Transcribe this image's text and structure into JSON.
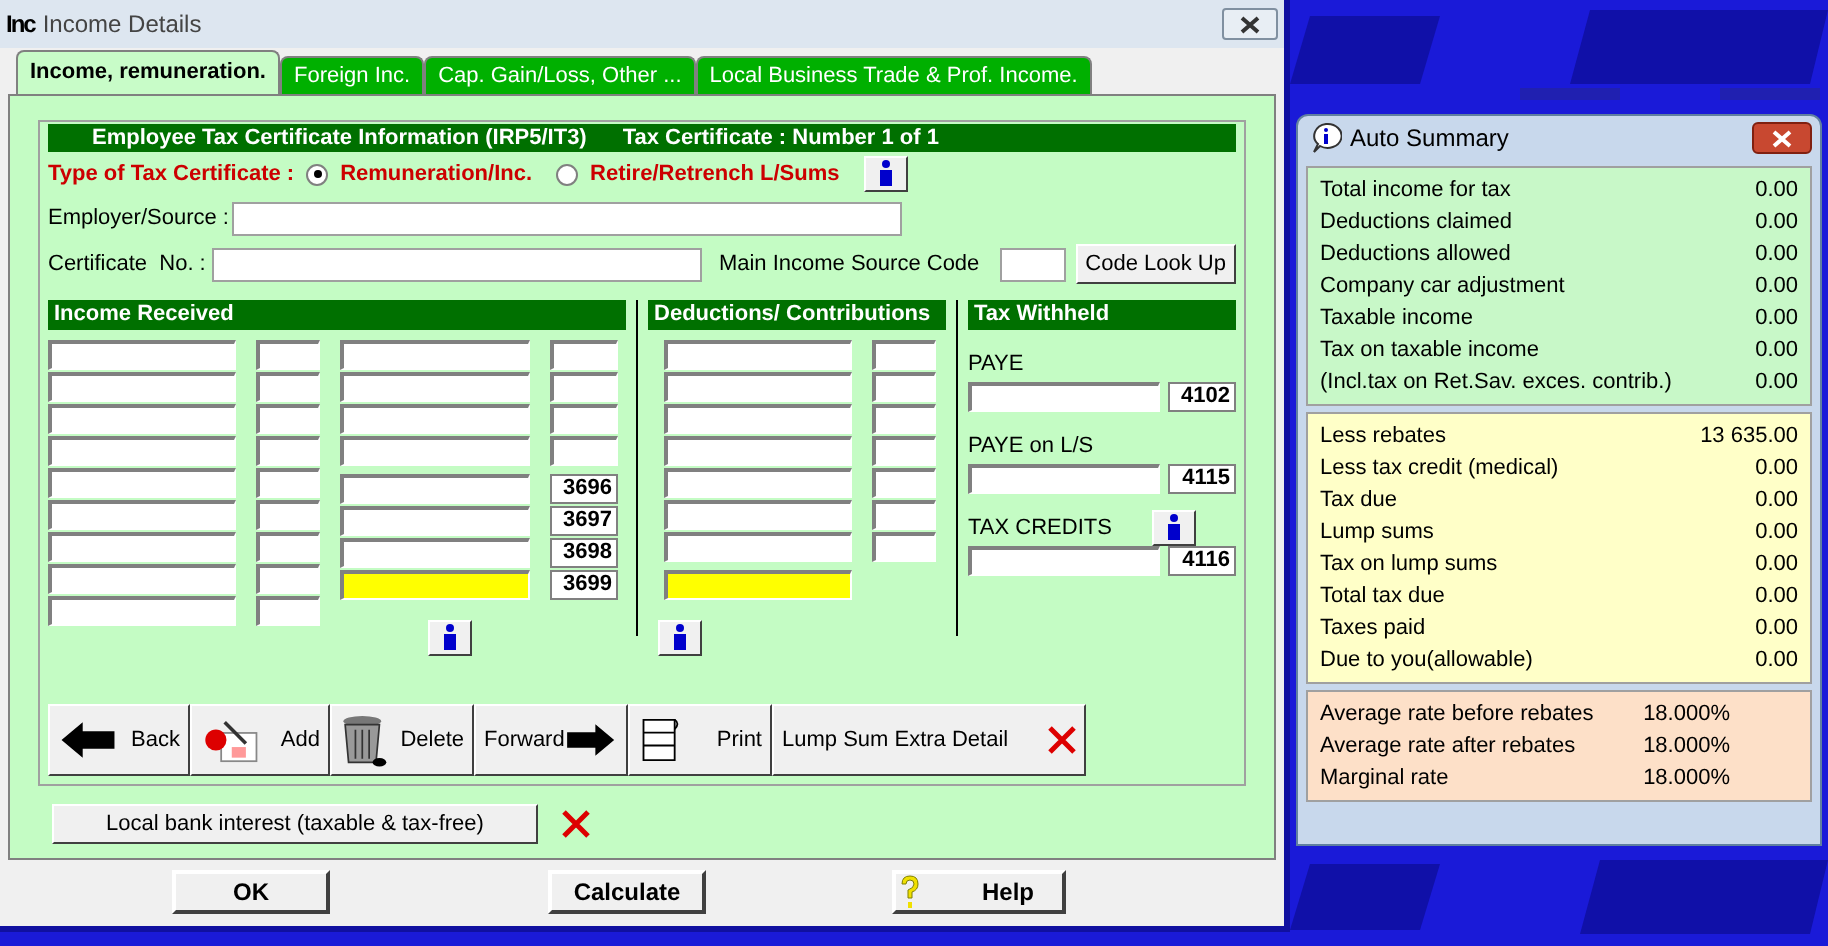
{
  "window": {
    "icon_text": "Inc",
    "title": "Income Details"
  },
  "tabs": [
    {
      "label": "Income, remuneration.",
      "selected": true
    },
    {
      "label": "Foreign Inc.",
      "selected": false
    },
    {
      "label": "Cap. Gain/Loss, Other ...",
      "selected": false
    },
    {
      "label": "Local Business Trade & Prof. Income.",
      "selected": false
    }
  ],
  "certificate": {
    "header": "Employee Tax Certificate Information (IRP5/IT3)",
    "number": "Tax Certificate : Number 1 of 1",
    "type_label": "Type of Tax Certificate :",
    "options": [
      {
        "label": "Remuneration/Inc.",
        "selected": true
      },
      {
        "label": "Retire/Retrench L/Sums",
        "selected": false
      }
    ],
    "employer_label": "Employer/Source :",
    "certificate_label": "Certificate  No. :",
    "source_code_label": "Main Income Source Code",
    "lookup_button": "Code Look Up"
  },
  "income": {
    "title": "Income Received",
    "codes": [
      "3696",
      "3697",
      "3698",
      "3699"
    ]
  },
  "deductions": {
    "title": "Deductions/ Contributions"
  },
  "tax_withheld": {
    "title": "Tax Withheld",
    "fields": [
      {
        "label": "PAYE",
        "code": "4102",
        "info": false
      },
      {
        "label": "PAYE on L/S",
        "code": "4115",
        "info": false
      },
      {
        "label": "TAX CREDITS",
        "code": "4116",
        "info": true
      }
    ]
  },
  "toolbar": [
    {
      "label": "Back",
      "kind": "back"
    },
    {
      "label": "Add",
      "kind": "add"
    },
    {
      "label": "Delete",
      "kind": "delete"
    },
    {
      "label": "Forward",
      "kind": "forward"
    },
    {
      "label": "Print",
      "kind": "print"
    },
    {
      "label": "Lump Sum Extra Detail",
      "kind": "lump"
    }
  ],
  "bank_button": "Local bank interest (taxable & tax-free)",
  "footer": [
    {
      "label": "OK",
      "kind": "ok"
    },
    {
      "label": "Calculate",
      "kind": "calc"
    },
    {
      "label": "Help",
      "kind": "help"
    }
  ],
  "summary": {
    "title": "Auto Summary",
    "sections": [
      {
        "kind": "totals",
        "rows": [
          {
            "label": "Total income for tax",
            "value": "0.00"
          },
          {
            "label": "Deductions claimed",
            "value": "0.00"
          },
          {
            "label": "Deductions allowed",
            "value": "0.00"
          },
          {
            "label": "Company car adjustment",
            "value": "0.00"
          },
          {
            "label": "Taxable income",
            "value": "0.00"
          },
          {
            "label": "Tax on taxable income",
            "value": "0.00"
          },
          {
            "label": "(Incl.tax on Ret.Sav. exces. contrib.)",
            "value": "0.00"
          }
        ]
      },
      {
        "kind": "tax",
        "rows": [
          {
            "label": "Less rebates",
            "value": "13 635.00"
          },
          {
            "label": "Less tax credit (medical)",
            "value": "0.00"
          },
          {
            "label": "Tax due",
            "value": "0.00"
          },
          {
            "label": "Lump sums",
            "value": "0.00"
          },
          {
            "label": "Tax on lump sums",
            "value": "0.00"
          },
          {
            "label": "Total tax due",
            "value": "0.00"
          },
          {
            "label": "Taxes paid",
            "value": "0.00"
          },
          {
            "label": "Due to you(allowable)",
            "value": "0.00"
          }
        ]
      },
      {
        "kind": "rates",
        "rows": [
          {
            "label": "Average rate before rebates",
            "value": "18.000%"
          },
          {
            "label": "Average rate after rebates",
            "value": "18.000%"
          },
          {
            "label": "Marginal rate",
            "value": "18.000%"
          }
        ]
      }
    ]
  }
}
